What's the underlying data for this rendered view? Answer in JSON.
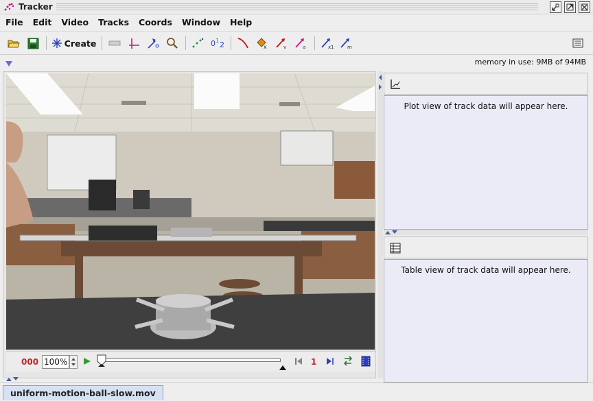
{
  "window": {
    "title": "Tracker"
  },
  "menu": [
    "File",
    "Edit",
    "Video",
    "Tracks",
    "Coords",
    "Window",
    "Help"
  ],
  "toolbar": {
    "create_label": "Create",
    "icons": [
      "open-folder-icon",
      "save-icon",
      "create-track-icon",
      "calibration-icon",
      "axes-icon",
      "autotracker-icon",
      "zoom-icon",
      "trails-icon",
      "labels-icon",
      "path-icon",
      "position-icon",
      "velocity-icon",
      "acceleration-icon",
      "center-of-mass-icon",
      "mass-icon",
      "notes-icon"
    ]
  },
  "status": {
    "memory": "memory in use: 9MB of 94MB"
  },
  "player": {
    "frame_counter": "000",
    "zoom": "100%",
    "start_frame": "1"
  },
  "plot_panel": {
    "message": "Plot view of track data will appear here."
  },
  "table_panel": {
    "message": "Table view of track data will appear here."
  },
  "tabs": [
    {
      "label": "uniform-motion-ball-slow.mov"
    }
  ],
  "colors": {
    "frame_counter": "#c3272b",
    "panel_background": "#ebebf7",
    "tab_active": "#d6e1f3"
  }
}
